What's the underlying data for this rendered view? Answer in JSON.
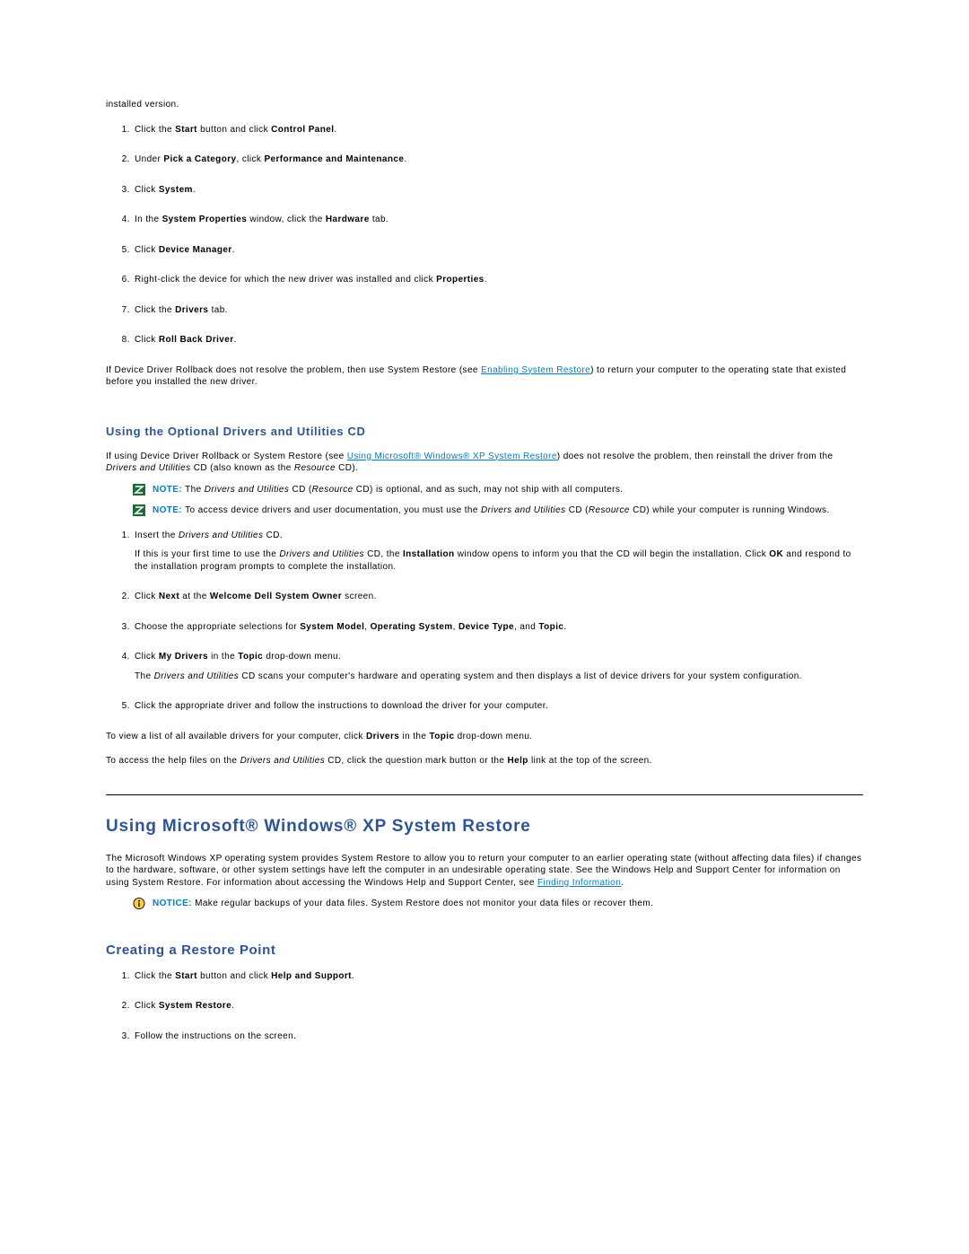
{
  "intro_line": "installed version.",
  "steps_rollback": {
    "s1_a": "Click the ",
    "s1_b": "Start",
    "s1_c": " button and click ",
    "s1_d": "Control Panel",
    "s1_e": ".",
    "s2_a": "Under ",
    "s2_b": "Pick a Category",
    "s2_c": ", click ",
    "s2_d": "Performance and Maintenance",
    "s2_e": ".",
    "s3_a": "Click ",
    "s3_b": "System",
    "s3_c": ".",
    "s4_a": "In the ",
    "s4_b": "System Properties",
    "s4_c": " window, click the ",
    "s4_d": "Hardware",
    "s4_e": " tab.",
    "s5_a": "Click ",
    "s5_b": "Device Manager",
    "s5_c": ".",
    "s6_a": "Right-click the device for which the new driver was installed and click ",
    "s6_b": "Properties",
    "s6_c": ".",
    "s7_a": "Click the ",
    "s7_b": "Drivers",
    "s7_c": " tab.",
    "s8_a": "Click ",
    "s8_b": "Roll Back Driver",
    "s8_c": "."
  },
  "rollback_para": {
    "a": "If Device Driver Rollback does not resolve the problem, then use System Restore (see ",
    "link": "Enabling System Restore",
    "b": ") to return your computer to the operating state that existed before you installed the new driver."
  },
  "heading_cd": "Using the Optional Drivers and Utilities CD",
  "cd_intro": {
    "a": "If using Device Driver Rollback or System Restore (see ",
    "link": "Using Microsoft® Windows® XP System Restore",
    "b": ") does not resolve the problem, then reinstall the driver from the ",
    "i1": "Drivers and Utilities",
    "c": " CD (also known as the ",
    "i2": "Resource",
    "d": " CD)."
  },
  "note1": {
    "label": "NOTE:",
    "a": " The ",
    "i1": "Drivers and Utilities",
    "b": " CD (",
    "i2": "Resource",
    "c": " CD) is optional, and as such, may not ship with all computers."
  },
  "note2": {
    "label": "NOTE:",
    "a": " To access device drivers and user documentation, you must use the ",
    "i1": "Drivers and Utilities",
    "b": " CD (",
    "i2": "Resource",
    "c": " CD) while your computer is running Windows."
  },
  "steps_cd": {
    "s1_a": "Insert the ",
    "s1_i": "Drivers and Utilities",
    "s1_b": " CD.",
    "s1_sub_a": "If this is your first time to use the ",
    "s1_sub_i": "Drivers and Utilities",
    "s1_sub_b": " CD, the ",
    "s1_sub_bold": "Installation",
    "s1_sub_c": " window opens to inform you that the CD will begin the installation. Click ",
    "s1_sub_bold2": "OK",
    "s1_sub_d": " and respond to the installation program prompts to complete the installation.",
    "s2_a": "Click ",
    "s2_b": "Next",
    "s2_c": " at the ",
    "s2_d": "Welcome Dell System Owner",
    "s2_e": " screen.",
    "s3_a": "Choose the appropriate selections for ",
    "s3_b": "System Model",
    "s3_c": ", ",
    "s3_d": "Operating System",
    "s3_e": ", ",
    "s3_f": "Device Type",
    "s3_g": ", and ",
    "s3_h": "Topic",
    "s3_i": ".",
    "s4_a": "Click ",
    "s4_b": "My Drivers",
    "s4_c": " in the ",
    "s4_d": "Topic",
    "s4_e": " drop-down menu.",
    "s4_sub_a": "The ",
    "s4_sub_i": "Drivers and Utilities",
    "s4_sub_b": " CD scans your computer's hardware and operating system and then displays a list of device drivers for your system configuration.",
    "s5": "Click the appropriate driver and follow the instructions to download the driver for your computer."
  },
  "cd_tail1": {
    "a": "To view a list of all available drivers for your computer, click ",
    "b": "Drivers",
    "c": " in the ",
    "d": "Topic",
    "e": " drop-down menu."
  },
  "cd_tail2": {
    "a": "To access the help files on the ",
    "i1": "Drivers and Utilities",
    "b": " CD, click the question mark button or the ",
    "bold": "Help",
    "c": " link at the top of the screen."
  },
  "heading_restore": "Using Microsoft® Windows® XP System Restore",
  "restore_intro": {
    "a": "The Microsoft Windows XP operating system provides System Restore to allow you to return your computer to an earlier operating state (without affecting data files) if changes to the hardware, software, or other system settings have left the computer in an undesirable operating state. See the Windows Help and Support Center for information on using System Restore. For information about accessing the Windows Help and Support Center, see ",
    "link": "Finding Information",
    "b": "."
  },
  "notice": {
    "label": "NOTICE:",
    "text": " Make regular backups of your data files. System Restore does not monitor your data files or recover them."
  },
  "heading_point": "Creating a Restore Point",
  "steps_point": {
    "s1_a": "Click the ",
    "s1_b": "Start",
    "s1_c": " button and click ",
    "s1_d": "Help and Support",
    "s1_e": ".",
    "s2_a": "Click ",
    "s2_b": "System Restore",
    "s2_c": ".",
    "s3": "Follow the instructions on the screen."
  }
}
